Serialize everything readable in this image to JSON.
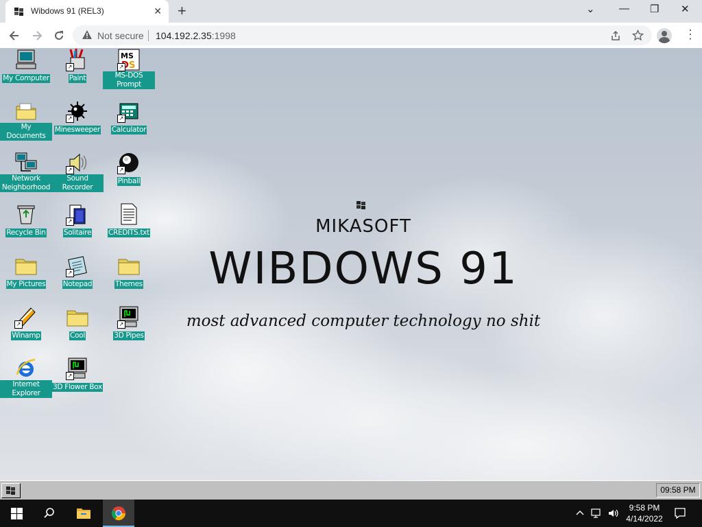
{
  "browser": {
    "tab_title": "Wibdows 91 (REL3)",
    "tab_close": "✕",
    "new_tab": "+",
    "window_controls": {
      "dropdown": "⌄",
      "minimize": "—",
      "maximize": "❐",
      "close": "✕"
    },
    "not_secure": "Not secure",
    "url_host": "104.192.2.35",
    "url_port": ":1998",
    "icons": [
      "back-icon",
      "forward-icon",
      "reload-icon",
      "warning-icon",
      "share-icon",
      "bookmark-star-icon",
      "profile-icon",
      "menu-icon"
    ]
  },
  "desktop": {
    "icons": [
      {
        "label": "My Computer",
        "icon": "computer-icon"
      },
      {
        "label": "Paint",
        "icon": "paint-icon"
      },
      {
        "label": "MS-DOS Prompt",
        "icon": "msdos-icon"
      },
      {
        "label": "My Documents",
        "icon": "folder-documents-icon"
      },
      {
        "label": "Minesweeper",
        "icon": "mine-icon"
      },
      {
        "label": "Calculator",
        "icon": "calculator-icon"
      },
      {
        "label": "Network Neighborhood",
        "icon": "network-icon"
      },
      {
        "label": "Sound Recorder",
        "icon": "speaker-icon"
      },
      {
        "label": "Pinball",
        "icon": "pinball-icon"
      },
      {
        "label": "Recycle Bin",
        "icon": "recycle-bin-icon"
      },
      {
        "label": "Solitaire",
        "icon": "cards-icon"
      },
      {
        "label": "CREDITS.txt",
        "icon": "text-file-icon"
      },
      {
        "label": "My Pictures",
        "icon": "folder-icon"
      },
      {
        "label": "Notepad",
        "icon": "notepad-icon"
      },
      {
        "label": "Themes",
        "icon": "folder-icon"
      },
      {
        "label": "Winamp",
        "icon": "winamp-icon"
      },
      {
        "label": "Cool",
        "icon": "folder-icon"
      },
      {
        "label": "3D Pipes",
        "icon": "screensaver-icon"
      },
      {
        "label": "Internet Explorer",
        "icon": "internet-explorer-icon"
      },
      {
        "label": "3D Flower Box",
        "icon": "screensaver-icon"
      }
    ],
    "brand": "MIKASOFT",
    "product": "WIBDOWS 91",
    "slogan": "most advanced computer technology no shit"
  },
  "taskbar95": {
    "clock": "09:58 PM"
  },
  "taskbar10": {
    "time": "9:58 PM",
    "date": "4/14/2022",
    "icons": [
      "windows-start-icon",
      "search-icon",
      "file-explorer-icon",
      "chrome-icon",
      "chevron-up-icon",
      "network-icon",
      "volume-icon",
      "notifications-icon"
    ]
  },
  "colors": {
    "icon_label_bg": "#16998c",
    "win95_gray": "#c0c0c0",
    "win10_taskbar": "#101010"
  }
}
